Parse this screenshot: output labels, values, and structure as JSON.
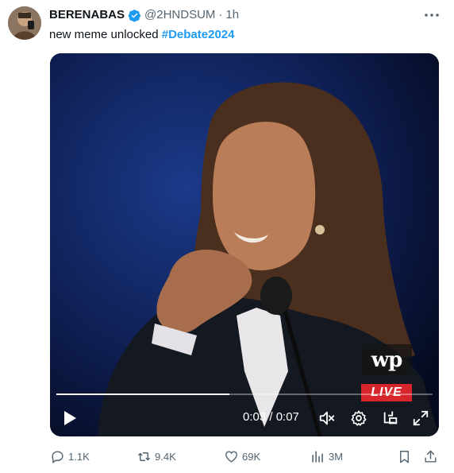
{
  "tweet": {
    "username": "BERENABAS",
    "handle": "@2HNDSUM",
    "separator": "·",
    "time": "1h",
    "text_plain": "new meme unlocked ",
    "hashtag": "#Debate2024",
    "avatar_icon": "user-avatar-icon",
    "verified_icon": "verified-badge-icon",
    "verified_color": "#1d9bf0"
  },
  "video": {
    "logo_text": "wp",
    "live_label": "LIVE",
    "current_time": "0:03",
    "duration": "0:07",
    "time_display": "0:03 / 0:07",
    "progress_fraction": 0.46,
    "controls": [
      "play-icon",
      "mute-icon",
      "settings-icon",
      "picture-in-picture-icon",
      "fullscreen-icon"
    ]
  },
  "actions": {
    "replies": "1.1K",
    "reposts": "9.4K",
    "likes": "69K",
    "views": "3M"
  },
  "colors": {
    "accent": "#1d9bf0",
    "muted": "#536471",
    "live": "#d7262b"
  }
}
